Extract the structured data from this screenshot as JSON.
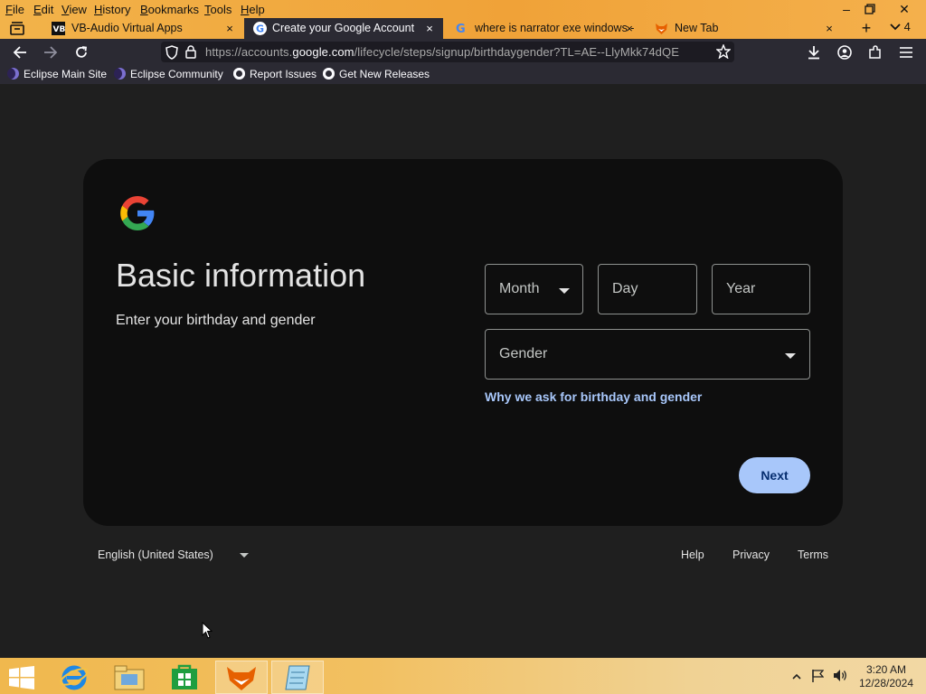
{
  "browser": {
    "menu": [
      "File",
      "Edit",
      "View",
      "History",
      "Bookmarks",
      "Tools",
      "Help"
    ],
    "tabs": [
      {
        "label": "VB-Audio Virtual Apps",
        "close": "×"
      },
      {
        "label": "Create your Google Account",
        "close": "×"
      },
      {
        "label": "where is narrator exe windows -",
        "close": "×"
      },
      {
        "label": "New Tab",
        "close": "×"
      }
    ],
    "tab_count": "4",
    "url_prefix": "https://accounts.",
    "url_domain": "google.com",
    "url_suffix": "/lifecycle/steps/signup/birthdaygender?TL=AE--LlyMkk74dQE",
    "bookmarks": [
      "Eclipse Main Site",
      "Eclipse Community",
      "Report Issues",
      "Get New Releases"
    ]
  },
  "page": {
    "title": "Basic information",
    "subtitle": "Enter your birthday and gender",
    "month_placeholder": "Month",
    "day_placeholder": "Day",
    "year_placeholder": "Year",
    "gender_placeholder": "Gender",
    "why_link": "Why we ask for birthday and gender",
    "next_label": "Next"
  },
  "footer": {
    "language": "English (United States)",
    "help": "Help",
    "privacy": "Privacy",
    "terms": "Terms"
  },
  "taskbar": {
    "time": "3:20 AM",
    "date": "12/28/2024"
  },
  "colors": {
    "accent": "#a8c7fa",
    "background": "#1f1f1f",
    "card": "#0e0e0e"
  }
}
